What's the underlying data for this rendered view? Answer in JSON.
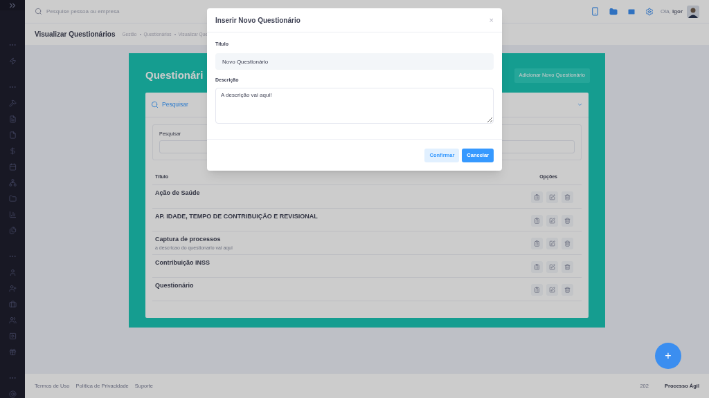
{
  "header": {
    "search_placeholder": "Pesquise pessoa ou empresa",
    "greeting": "Olá,",
    "user": "Igor"
  },
  "subheader": {
    "title": "Visualizar Questionários",
    "breadcrumbs": [
      "Gestão",
      "Questionários",
      "Visualizar Que"
    ]
  },
  "card": {
    "title": "Questionári",
    "add_button": "Adicionar Novo Questionário",
    "search": {
      "toggle": "Pesquisar",
      "expanded": true,
      "field_label": "Pesquisar"
    },
    "table": {
      "columns": [
        "Título",
        "Opções"
      ],
      "rows": [
        {
          "title": "Ação de Saúde"
        },
        {
          "title": "AP. IDADE, TEMPO DE CONTRIBUIÇÃO E REVISIONAL"
        },
        {
          "title": "Captura de processos",
          "description": "a descricao do questionario vai aqui"
        },
        {
          "title": "Contribuição INSS"
        },
        {
          "title": "Questionário"
        }
      ]
    }
  },
  "modal": {
    "title": "Inserir Novo Questionário",
    "close": "×",
    "fields": [
      {
        "kind": "input",
        "label": "Título",
        "value": "Novo Questionário"
      },
      {
        "kind": "textarea",
        "label": "Descrição",
        "value": "A descrição vai aqui!"
      }
    ],
    "buttons": [
      {
        "label": "Confirmar",
        "kind": "secondary"
      },
      {
        "label": "Cancelar",
        "kind": "primary"
      }
    ]
  },
  "footer": {
    "links": [
      "Termos de Uso",
      "Política de Privacidade",
      "Suporte"
    ],
    "year": "202",
    "brand": "Processo Ágil"
  },
  "fab": "+"
}
